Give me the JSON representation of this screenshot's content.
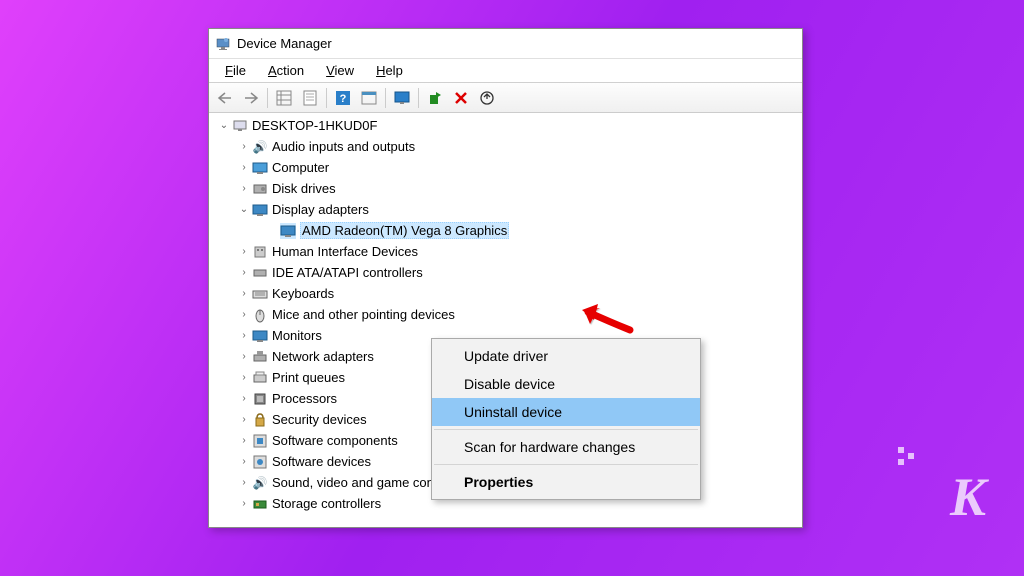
{
  "window": {
    "title": "Device Manager"
  },
  "menubar": {
    "items": [
      "File",
      "Action",
      "View",
      "Help"
    ]
  },
  "tree": {
    "root": "DESKTOP-1HKUD0F",
    "categories": [
      {
        "label": "Audio inputs and outputs",
        "expanded": false
      },
      {
        "label": "Computer",
        "expanded": false
      },
      {
        "label": "Disk drives",
        "expanded": false
      },
      {
        "label": "Display adapters",
        "expanded": true,
        "children": [
          {
            "label": "AMD Radeon(TM) Vega 8 Graphics",
            "selected": true
          }
        ]
      },
      {
        "label": "Human Interface Devices",
        "expanded": false
      },
      {
        "label": "IDE ATA/ATAPI controllers",
        "expanded": false
      },
      {
        "label": "Keyboards",
        "expanded": false
      },
      {
        "label": "Mice and other pointing devices",
        "expanded": false
      },
      {
        "label": "Monitors",
        "expanded": false
      },
      {
        "label": "Network adapters",
        "expanded": false
      },
      {
        "label": "Print queues",
        "expanded": false
      },
      {
        "label": "Processors",
        "expanded": false
      },
      {
        "label": "Security devices",
        "expanded": false
      },
      {
        "label": "Software components",
        "expanded": false
      },
      {
        "label": "Software devices",
        "expanded": false
      },
      {
        "label": "Sound, video and game controllers",
        "expanded": false
      },
      {
        "label": "Storage controllers",
        "expanded": false
      }
    ]
  },
  "context_menu": {
    "items": [
      {
        "label": "Update driver",
        "highlighted": false
      },
      {
        "label": "Disable device",
        "highlighted": false
      },
      {
        "label": "Uninstall device",
        "highlighted": true
      },
      {
        "separator": true
      },
      {
        "label": "Scan for hardware changes",
        "highlighted": false
      },
      {
        "separator": true
      },
      {
        "label": "Properties",
        "highlighted": false,
        "bold": true
      }
    ]
  },
  "watermark": "K"
}
